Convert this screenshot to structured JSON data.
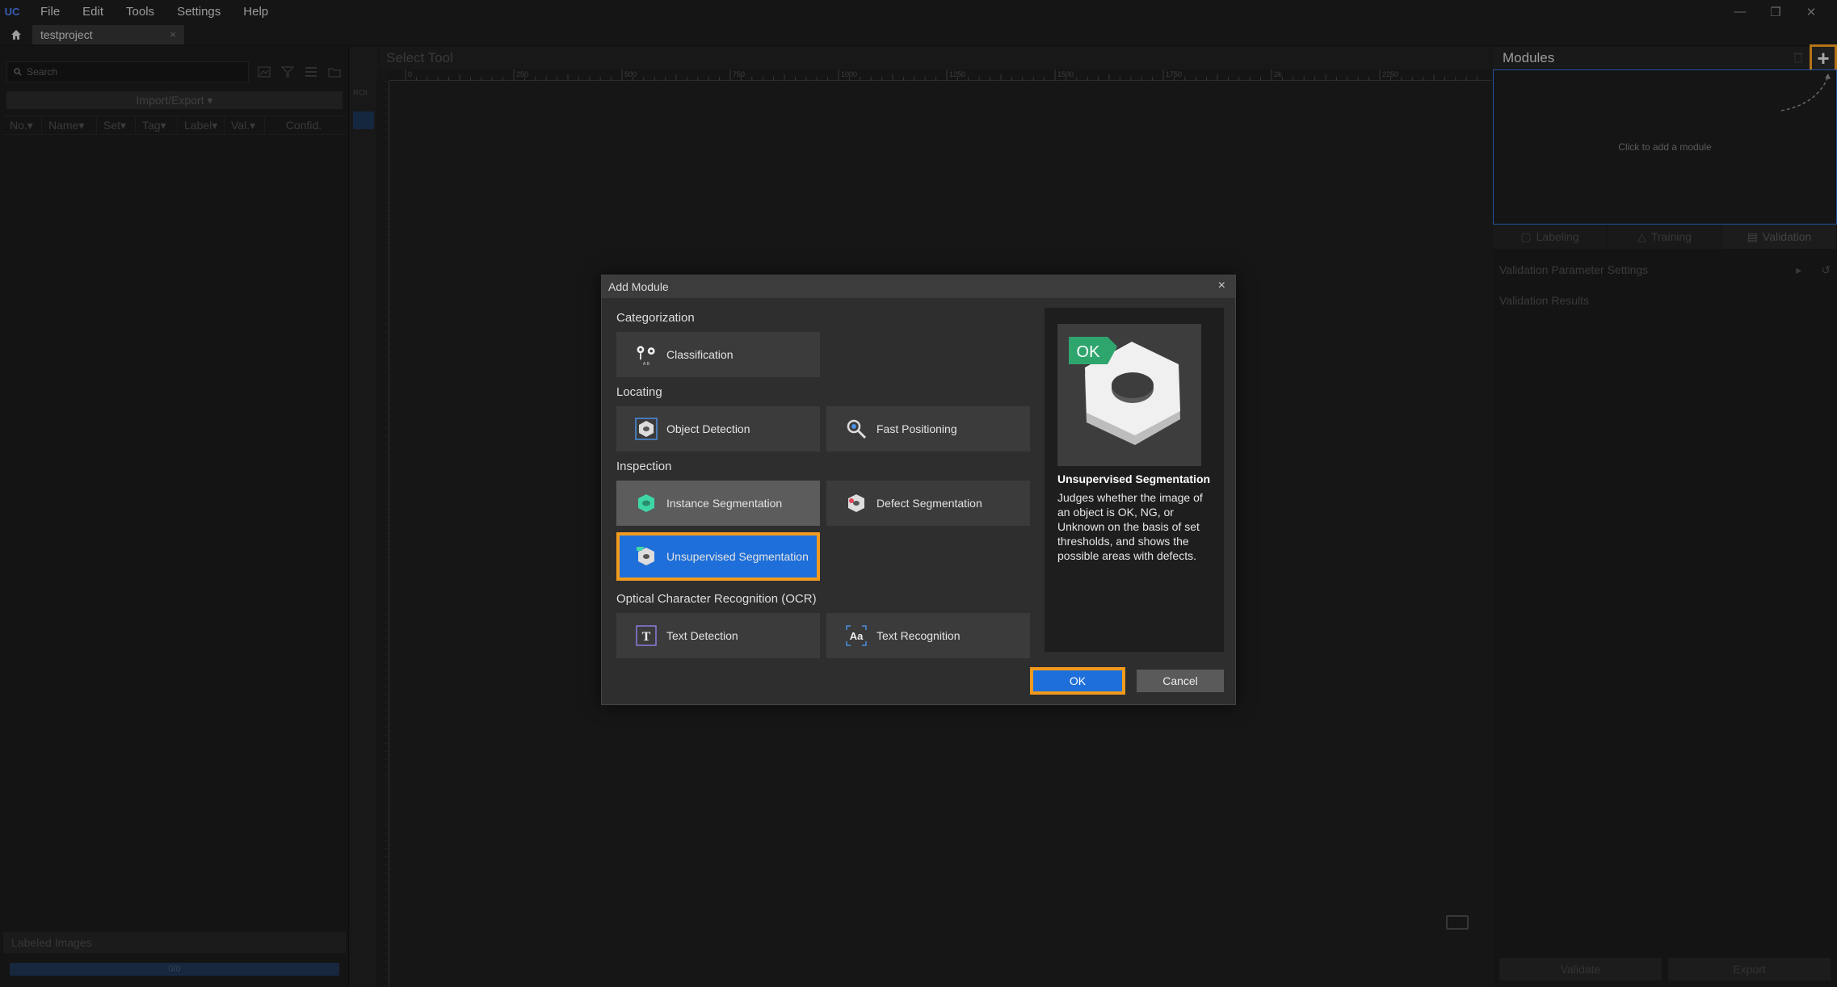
{
  "app": {
    "logo": "UC"
  },
  "menu": [
    "File",
    "Edit",
    "Tools",
    "Settings",
    "Help"
  ],
  "window_controls": {
    "minimize": "—",
    "restore": "❐",
    "close": "✕"
  },
  "project_tab": {
    "label": "testproject",
    "close": "×"
  },
  "left_panel": {
    "search_placeholder": "Search",
    "import_export": "Import/Export ▾",
    "columns": [
      "No.▾",
      "Name▾",
      "Set▾",
      "Tag▾",
      "Label▾",
      "Val.▾",
      "Confid."
    ],
    "labeled_images": "Labeled Images",
    "progress_text": "0/0",
    "progress_fraction": 0
  },
  "canvas": {
    "title": "Select Tool",
    "roi_label": "ROI",
    "ruler_ticks": [
      "0",
      "250",
      "500",
      "750",
      "1000",
      "1250",
      "1500",
      "1750",
      "2k",
      "2250"
    ]
  },
  "right_panel": {
    "title": "Modules",
    "add_icon": "+",
    "click_to_add": "Click to add a module",
    "tabs": [
      {
        "label": "Labeling",
        "icon": "labeling-icon"
      },
      {
        "label": "Training",
        "icon": "training-icon"
      },
      {
        "label": "Validation",
        "icon": "validation-icon"
      }
    ],
    "param_settings": "Validation Parameter Settings",
    "results": "Validation Results",
    "validate": "Validate",
    "export": "Export"
  },
  "dialog": {
    "title": "Add Module",
    "close": "×",
    "sections": {
      "categorization": "Categorization",
      "locating": "Locating",
      "inspection": "Inspection",
      "ocr": "Optical Character Recognition (OCR)"
    },
    "modules": {
      "classification": "Classification",
      "object_detection": "Object Detection",
      "fast_positioning": "Fast Positioning",
      "instance_segmentation": "Instance Segmentation",
      "defect_segmentation": "Defect Segmentation",
      "unsupervised_segmentation": "Unsupervised Segmentation",
      "text_detection": "Text Detection",
      "text_recognition": "Text Recognition"
    },
    "icon_text": {
      "classification_labels": "A  B",
      "text_detection": "T",
      "text_recognition": "Aa"
    },
    "preview": {
      "badge": "OK",
      "title": "Unsupervised Segmentation",
      "description": "Judges whether the image of an object is OK, NG, or Unknown on the basis of set thresholds, and shows the possible areas with defects."
    },
    "ok": "OK",
    "cancel": "Cancel"
  },
  "colors": {
    "accent_blue": "#1e6fd9",
    "highlight_orange": "#f29a1d"
  }
}
